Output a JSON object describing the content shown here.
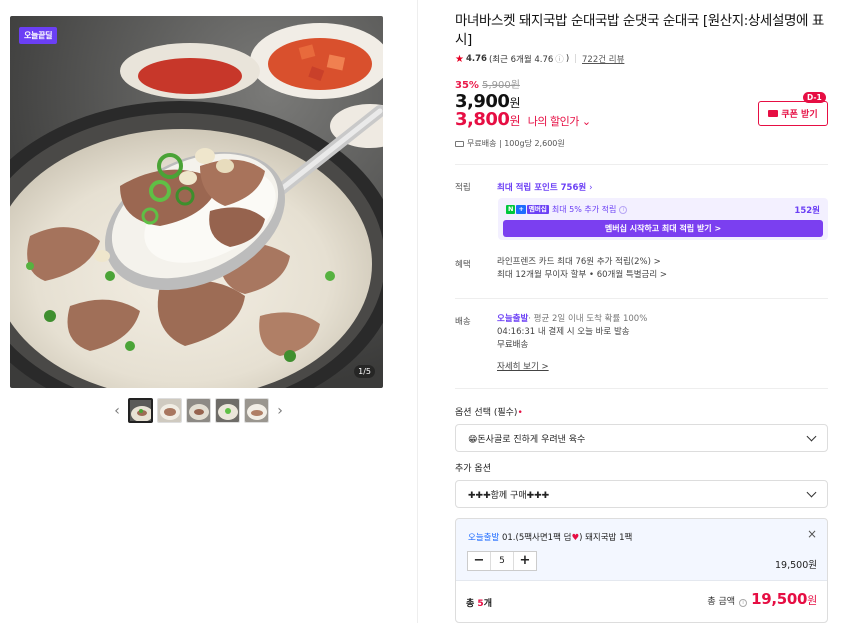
{
  "gallery": {
    "badge": "오늘끝딜",
    "pager": "1/5",
    "prev_arrow": "‹",
    "next_arrow": "›",
    "thumb_count": 5
  },
  "product": {
    "title": "마녀바스켓 돼지국밥 순대국밥 순댓국 순대국 [원산지:상세설명에 표시]",
    "rating": "4.76",
    "rating_recent": "(최근 6개월 4.76",
    "rating_info_icon": "ⓘ",
    "rating_close": ")",
    "reviews": "722건 리뷰",
    "discount_pct": "35%",
    "original_price": "5,900원",
    "price": "3,900",
    "price_won": "원",
    "my_price": "3,800",
    "my_price_won": "원",
    "my_discount_label": "나의 할인가 ⌄",
    "coupon_label": "쿠폰 받기",
    "coupon_dday": "D-1",
    "shipping_small": "무료배송 | 100g당 2,600원"
  },
  "points": {
    "label": "적립",
    "max_point_link": "최대 적립 포인트 756원",
    "member_text": "최대 5% 추가 적립",
    "member_amount": "152원",
    "member_button": "멤버십 시작하고 최대 적립 받기 >",
    "npay_n": "N",
    "npay_plus": "+",
    "npay_m": "멤버십"
  },
  "benefit": {
    "label": "혜택",
    "line1": "라인프렌즈 카드 최대 76원 추가 적립(2%) >",
    "line2": "최대 12개월 무이자 할부 • 60개월 특별금리 >"
  },
  "shipping": {
    "label": "배송",
    "today": "오늘출발",
    "eta": "· 평균 2일 이내 도착 확률 100%",
    "line2": "04:16:31 내 결제 시 오늘 바로 발송",
    "line3": "무료배송",
    "details_link": "자세히 보기 >"
  },
  "options": {
    "label": "옵션 선택 (필수)",
    "required_mark": "•",
    "selected": "😁돈사골로 진하게 우려낸 육수",
    "extra_label": "추가 옵션",
    "extra_selected": "✚✚✚함께 구매✚✚✚"
  },
  "cart": {
    "today": "오늘출발",
    "item_name_pre": "01.(5팩사면1팩 덤",
    "item_heart": "♥",
    "item_name_post": ") 돼지국밥 1팩",
    "close": "×",
    "minus": "−",
    "qty": "5",
    "plus": "+",
    "item_price": "19,500원",
    "total_count_pre": "총 ",
    "total_count_num": "5",
    "total_count_post": "개",
    "total_label": "총 금액",
    "total_info_icon": "i",
    "total_amount": "19,500",
    "total_won": "원"
  },
  "colors": {
    "accent_red": "#e60e43",
    "accent_purple": "#6b3ff5",
    "today_blue": "#1e6bff"
  }
}
